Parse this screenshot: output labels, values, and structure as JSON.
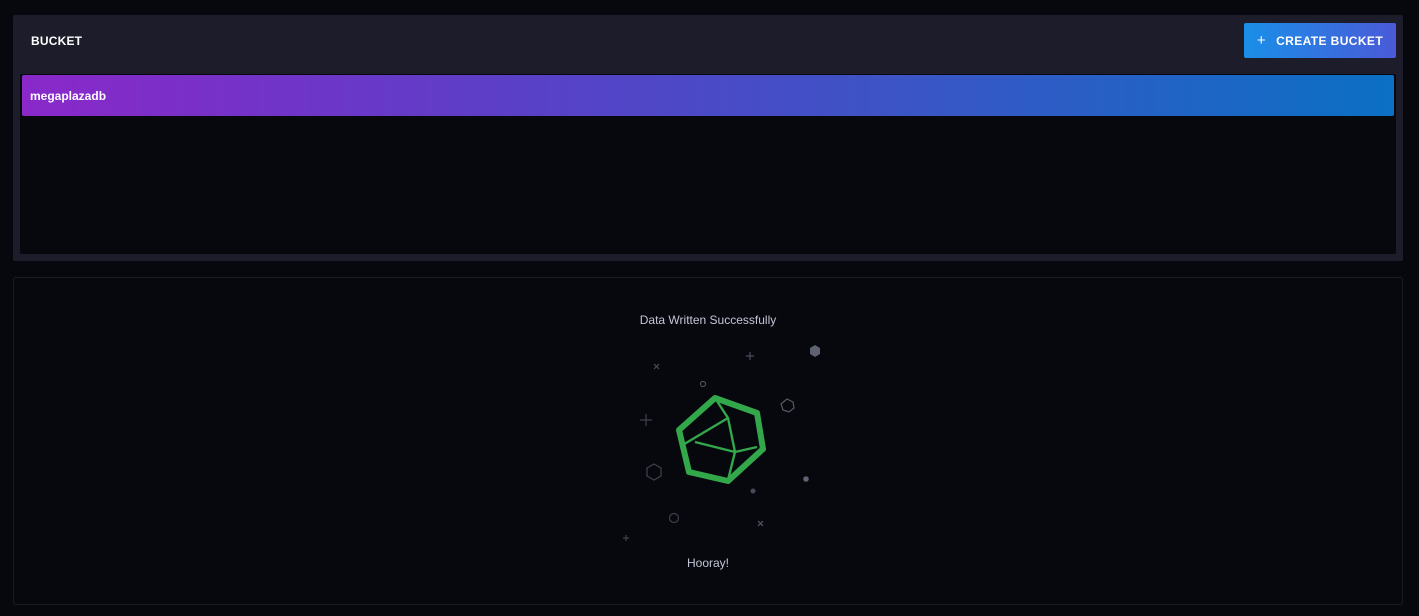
{
  "bucket_panel": {
    "title": "BUCKET",
    "create_button_label": "CREATE BUCKET",
    "create_button_icon": "plus-icon",
    "items": [
      {
        "name": "megaplazadb"
      }
    ]
  },
  "status": {
    "message": "Data Written Successfully",
    "footer": "Hooray!",
    "icon": "success-polyhedron-icon",
    "accent_color": "#32a84b"
  }
}
